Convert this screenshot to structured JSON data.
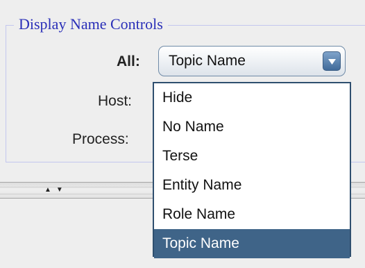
{
  "panel": {
    "title": "Display Name Controls"
  },
  "controls": {
    "all_label": "All:",
    "host_label": "Host:",
    "process_label": "Process:",
    "all_selected": "Topic Name"
  },
  "dropdown": {
    "items": [
      {
        "label": "Hide"
      },
      {
        "label": "No Name"
      },
      {
        "label": "Terse"
      },
      {
        "label": "Entity Name"
      },
      {
        "label": "Role Name"
      },
      {
        "label": "Topic Name",
        "selected": true
      }
    ]
  },
  "splitter": {
    "arrows": "▲▼"
  },
  "colors": {
    "legend": "#2a2fb8",
    "selection": "#3f6488",
    "border": "#c3c6ee"
  }
}
